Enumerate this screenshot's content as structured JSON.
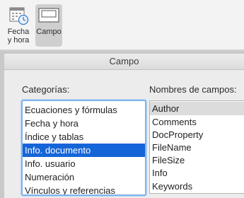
{
  "ribbon": {
    "buttons": [
      {
        "label": "Fecha\ny hora",
        "icon": "calendar-clock-icon"
      },
      {
        "label": "Campo",
        "icon": "field-icon",
        "selected": true
      }
    ]
  },
  "dialog": {
    "title": "Campo",
    "categories_label": "Categorías:",
    "field_names_label": "Nombres de campos:",
    "categories": [
      "Ecuaciones y fórmulas",
      "Fecha y hora",
      "Índice y tablas",
      "Info. documento",
      "Info. usuario",
      "Numeración",
      "Vínculos y referencias"
    ],
    "categories_selected": "Info. documento",
    "field_names": [
      "Author",
      "Comments",
      "DocProperty",
      "FileName",
      "FileSize",
      "Info",
      "Keywords"
    ],
    "field_names_selected": "Author"
  },
  "colors": {
    "selection_blue": "#1665d8",
    "focus_ring": "#7fb4ea"
  }
}
